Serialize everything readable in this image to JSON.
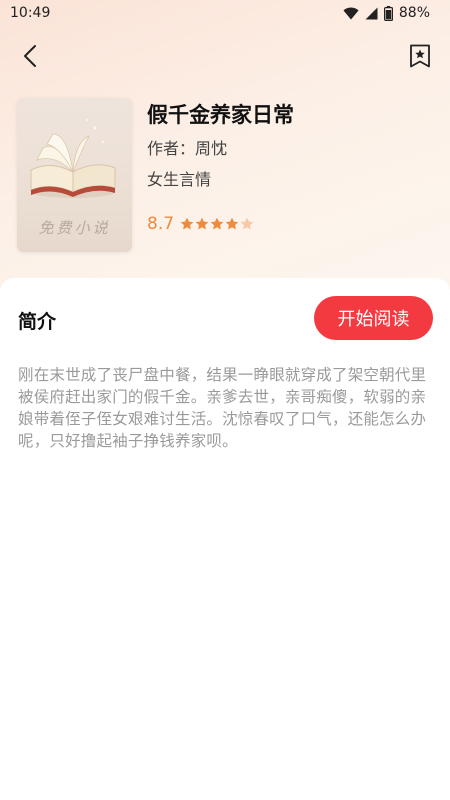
{
  "status_bar": {
    "time": "10:49",
    "battery": "88%"
  },
  "book": {
    "title": "假千金养家日常",
    "author": "作者：周忱",
    "category": "女生言情",
    "rating": "8.7",
    "stars_filled": 4,
    "stars_total": 5,
    "cover_text": "免费小说"
  },
  "intro": {
    "heading": "简介",
    "start_button": "开始阅读",
    "text": "刚在末世成了丧尸盘中餐，结果一睁眼就穿成了架空朝代里被侯府赶出家门的假千金。亲爹去世，亲哥痴傻，软弱的亲娘带着侄子侄女艰难讨生活。沈惊春叹了口气，还能怎么办呢，只好撸起袖子挣钱养家呗。"
  },
  "colors": {
    "accent": "#f33a40",
    "rating": "#f08a3c"
  },
  "icons": {
    "back": "chevron-left-icon",
    "bookmark": "bookmark-star-icon",
    "wifi": "wifi-icon",
    "signal": "signal-icon",
    "battery": "battery-icon"
  }
}
